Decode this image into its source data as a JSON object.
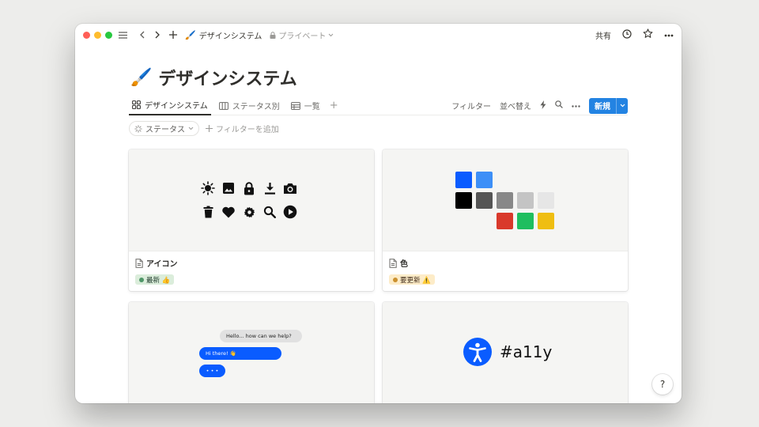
{
  "titlebar": {
    "breadcrumb_emoji": "🖌️",
    "breadcrumb_title": "デザインシステム",
    "privacy_label": "プライベート",
    "share_label": "共有"
  },
  "page": {
    "emoji": "🖌️",
    "title": "デザインシステム"
  },
  "views": [
    {
      "label": "デザインシステム",
      "icon": "gallery-icon",
      "active": true
    },
    {
      "label": "ステータス別",
      "icon": "board-icon",
      "active": false
    },
    {
      "label": "一覧",
      "icon": "table-icon",
      "active": false
    }
  ],
  "view_actions": {
    "filter_label": "フィルター",
    "sort_label": "並べ替え",
    "new_label": "新規"
  },
  "filters": {
    "status_chip": "ステータス",
    "add_filter": "フィルターを追加"
  },
  "cards": [
    {
      "name": "アイコン",
      "tag": "最新 👍",
      "tag_color": "green"
    },
    {
      "name": "色",
      "tag": "要更新 ⚠️",
      "tag_color": "yellow"
    }
  ],
  "chat_preview": {
    "incoming": "Hello... how can we help?",
    "outgoing": "Hi there! 👋",
    "typing": "• • •"
  },
  "a11y_preview": {
    "label": "#a11y"
  },
  "palette": {
    "blue": "#0a5cff",
    "light_blue": "#3d8ff7",
    "black": "#000000",
    "dark_gray": "#555555",
    "gray": "#888888",
    "light_gray": "#c4c4c4",
    "pale_gray": "#e6e6e6",
    "red": "#d9392b",
    "green": "#1fbe5f",
    "yellow": "#efbe12"
  },
  "help_label": "?"
}
